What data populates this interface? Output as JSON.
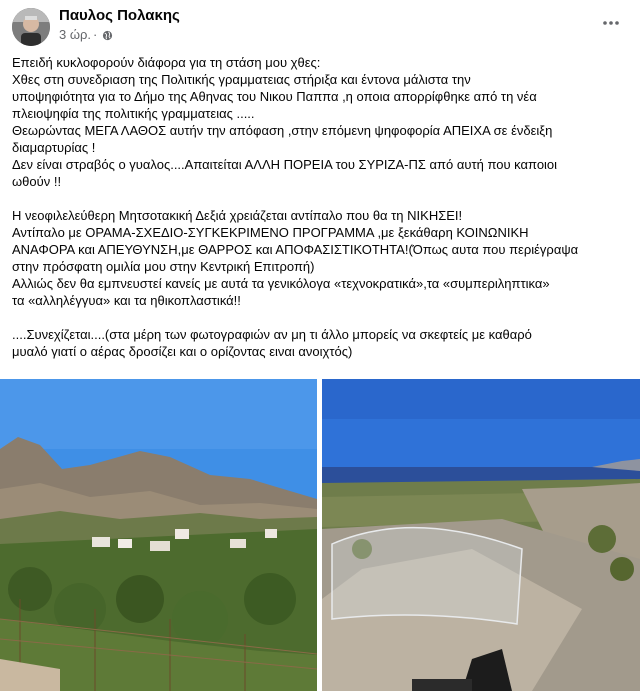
{
  "post": {
    "author": "Παυλος Πολακης",
    "time": "3 ώρ.",
    "separator": "·",
    "privacy_icon": "globe-icon",
    "more_icon": "more-horizontal-icon",
    "paragraphs": [
      [
        "Επειδή κυκλοφορούν διάφορα για τη στάση μου χθες:",
        "Χθες στη συνεδριαση της Πολιτικής γραμματειας στήριξα και έντονα μάλιστα την",
        "υποψηφιότητα για το Δήμο της Αθηνας  του Νικου Παππα ,η οποια απορρίφθηκε από τη νέα",
        "πλειοψηφία της πολιτικής γραμματειας .....",
        "Θεωρώντας ΜΕΓΑ ΛΑΘΟΣ αυτήν την απόφαση ,στην επόμενη ψηφοφορία ΑΠΕΙΧΑ σε ένδειξη",
        "διαμαρτυρίας !",
        "Δεν είναι στραβός ο γυαλος....Απαιτείται ΑΛΛΗ ΠΟΡΕΙΑ του ΣΥΡΙΖΑ-ΠΣ από αυτή που καποιοι",
        "ωθούν !!"
      ],
      [
        "Η νεοφιλελεύθερη Μητσοτακική Δεξιά χρειάζεται αντίπαλο που θα τη ΝΙΚΗΣΕΙ!",
        "Αντίπαλο με ΟΡΑΜΑ-ΣΧΕΔΙΟ-ΣΥΓΚΕΚΡΙΜΕΝΟ ΠΡΟΓΡΑΜΜΑ ,με ξεκάθαρη  ΚΟΙΝΩΝΙΚΗ",
        "ΑΝΑΦΟΡΑ και ΑΠΕΥΘΥΝΣΗ,με ΘΑΡΡΟΣ και ΑΠΟΦΑΣΙΣΤΙΚΟΤΗΤΑ!(Όπως αυτα που περιέγραψα",
        "στην πρόσφατη ομιλία μου στην Κεντρική Επιτροπή)",
        "Αλλιώς δεν θα εμπνευστεί κανείς με αυτά τα γενικόλογα «τεχνοκρατικά»,τα «συμπεριληπτικα»",
        "τα «αλληλέγγυα» και τα ηθικοπλαστικά!!"
      ],
      [
        "....Συνεχίζεται....(στα μέρη των φωτογραφιών  αν μη τι άλλο μπορείς να σκεφτείς με καθαρό",
        "μυαλό γιατί ο αέρας δροσίζει και ο ορίζοντας ειναι ανοιχτός)"
      ]
    ]
  },
  "photos": [
    {
      "name": "mountain-village-photo",
      "sky": "#3f8fe6",
      "mountain": "#8a7d6d",
      "trees": "#4d6b2e"
    },
    {
      "name": "sea-view-dirt-road-photo",
      "sky": "#2f72d8",
      "sea": "#2c4f9a",
      "ground": "#a29a8c"
    }
  ]
}
